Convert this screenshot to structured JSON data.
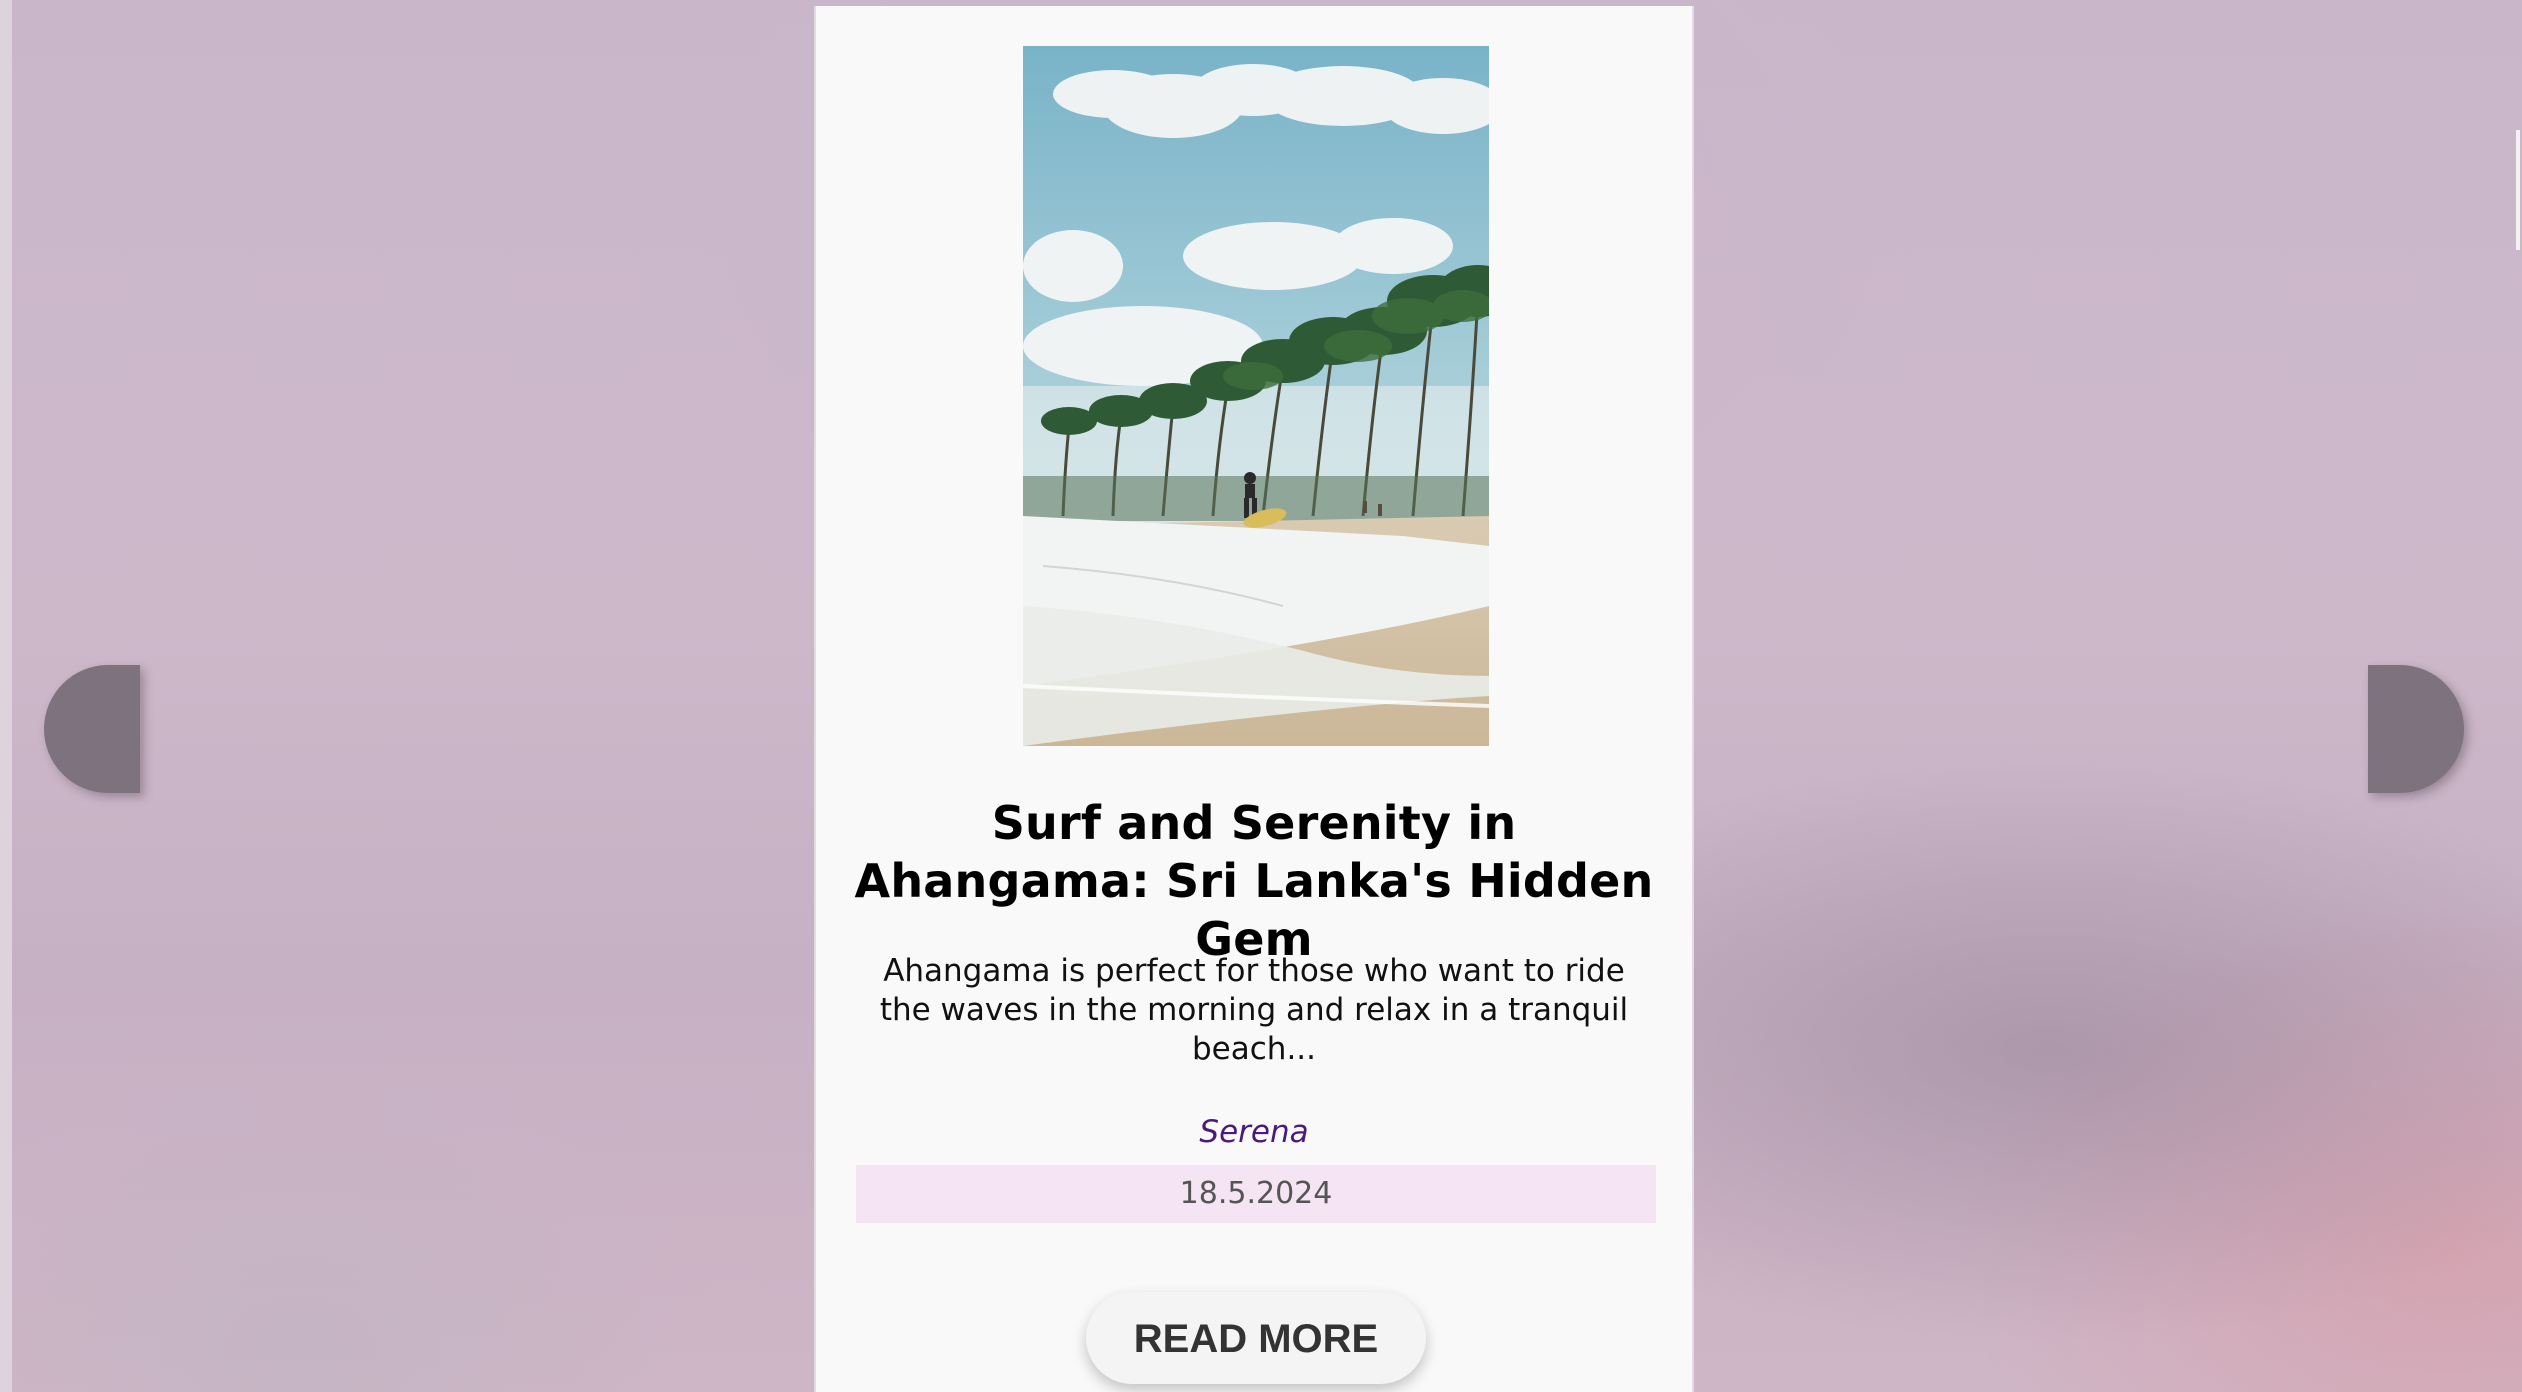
{
  "post": {
    "title": "Surf and Serenity in Ahangama: Sri Lanka's Hidden Gem",
    "excerpt": "Ahangama is perfect for those who want to ride the waves in the morning and relax in a tranquil beach...",
    "author": "Serena",
    "date": "18.5.2024",
    "read_more_label": "READ MORE",
    "image_icon": "beach-photo"
  },
  "navigation": {
    "prev_icon": "previous-arrow",
    "next_icon": "next-arrow"
  },
  "colors": {
    "background": "#c9b7c9",
    "card": "#f9f9f9",
    "author": "#4b1a7a",
    "date_bar": "#f5e4f3",
    "nav_button": "#7e727f"
  }
}
